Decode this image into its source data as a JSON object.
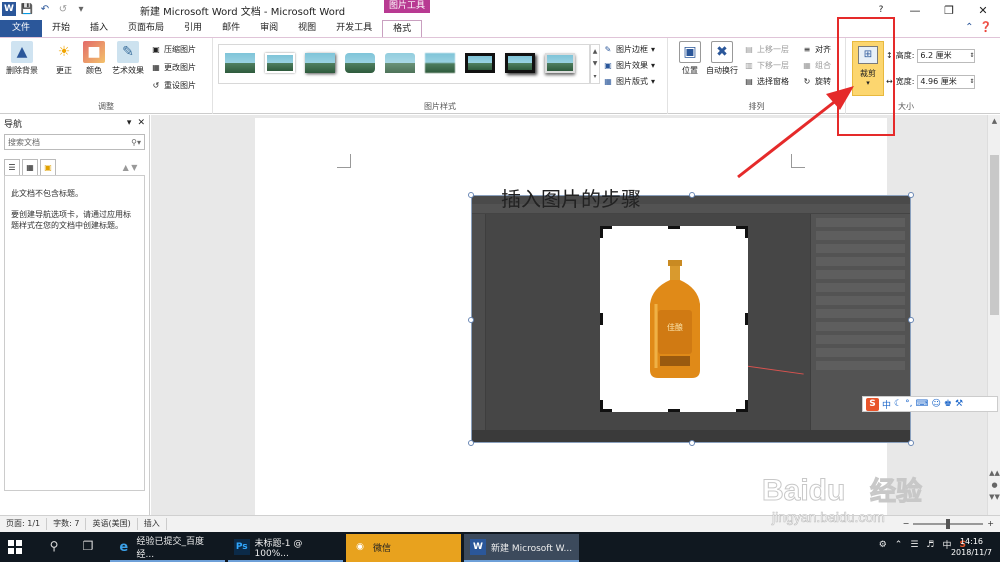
{
  "titlebar": {
    "doc_title": "新建 Microsoft Word 文档 - Microsoft Word",
    "tool_tab": "图片工具"
  },
  "tabs": [
    "文件",
    "开始",
    "插入",
    "页面布局",
    "引用",
    "邮件",
    "审阅",
    "视图",
    "开发工具",
    "格式"
  ],
  "ribbon": {
    "adjust": {
      "remove_bg": "删除背景",
      "correct": "更正",
      "color": "颜色",
      "artistic": "艺术效果",
      "compress": "压缩图片",
      "change": "更改图片",
      "reset": "重设图片",
      "label": "调整"
    },
    "styles": {
      "border": "图片边框",
      "effect": "图片效果",
      "layout": "图片版式",
      "label": "图片样式"
    },
    "arrange": {
      "position": "位置",
      "wrap": "自动换行",
      "forward": "上移一层",
      "backward": "下移一层",
      "pane": "选择窗格",
      "align": "对齐",
      "group": "组合",
      "rotate": "旋转",
      "label": "排列"
    },
    "size": {
      "crop": "裁剪",
      "height_label": "高度:",
      "height_value": "6.2 厘米",
      "width_label": "宽度:",
      "width_value": "4.96 厘米",
      "label": "大小"
    }
  },
  "nav": {
    "title": "导航",
    "search_placeholder": "搜索文档",
    "msg1": "此文档不包含标题。",
    "msg2": "要创建导航选项卡，请通过应用标题样式在您的文档中创建标题。"
  },
  "document": {
    "heading": "插入图片的步骤",
    "bottle_label": "佳酿"
  },
  "ime": {
    "mode": "中"
  },
  "statusbar": {
    "page": "页面: 1/1",
    "words": "字数: 7",
    "lang": "英语(美国)",
    "mode": "插入"
  },
  "taskbar": {
    "apps": [
      {
        "label": "经验已提交_百度经..."
      },
      {
        "label": "未标题-1 @ 100%..."
      },
      {
        "label": "微信"
      },
      {
        "label": "新建 Microsoft W..."
      }
    ],
    "tray_ime": "中",
    "time": "14:16",
    "date": "2018/11/7"
  },
  "watermark": {
    "brand": "Baidu",
    "suffix": "经验",
    "url": "jingyan.baidu.com"
  },
  "colors": {
    "word_blue": "#2b579a",
    "picture_tools_accent": "#b83a92",
    "crop_highlight": "#fcd66f",
    "annotation_red": "#e52a2a"
  }
}
